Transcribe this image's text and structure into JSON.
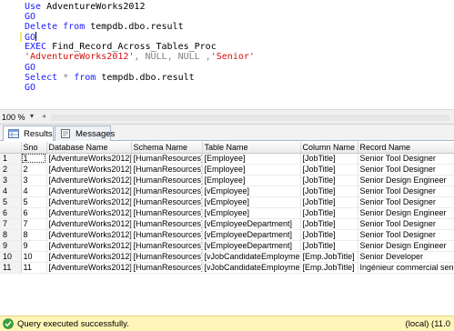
{
  "editor": {
    "lines": [
      {
        "id": "use",
        "parts": [
          {
            "cls": "kw",
            "text": "Use "
          },
          {
            "cls": "txt",
            "text": "AdventureWorks2012"
          }
        ]
      },
      {
        "id": "go1",
        "parts": [
          {
            "cls": "kw",
            "text": "GO"
          }
        ]
      },
      {
        "id": "delete",
        "parts": [
          {
            "cls": "kw",
            "text": "Delete from "
          },
          {
            "cls": "txt",
            "text": "tempdb.dbo.result"
          }
        ]
      },
      {
        "id": "go2",
        "current": true,
        "parts": [
          {
            "cls": "kw",
            "text": "GO"
          }
        ]
      },
      {
        "id": "exec",
        "parts": [
          {
            "cls": "kw",
            "text": "EXEC "
          },
          {
            "cls": "txt",
            "text": "Find_Record_Across_Tables_Proc"
          }
        ]
      },
      {
        "id": "args",
        "parts": [
          {
            "cls": "str",
            "text": "'AdventureWorks2012'"
          },
          {
            "cls": "gray",
            "text": ", "
          },
          {
            "cls": "gray",
            "text": "NULL"
          },
          {
            "cls": "gray",
            "text": ", "
          },
          {
            "cls": "gray",
            "text": "NULL"
          },
          {
            "cls": "gray",
            "text": " ,"
          },
          {
            "cls": "str",
            "text": "'Senior'"
          }
        ]
      },
      {
        "id": "go3",
        "parts": [
          {
            "cls": "kw",
            "text": "GO"
          }
        ]
      },
      {
        "id": "select",
        "parts": [
          {
            "cls": "kw",
            "text": "Select "
          },
          {
            "cls": "gray",
            "text": "* "
          },
          {
            "cls": "kw",
            "text": "from "
          },
          {
            "cls": "txt",
            "text": "tempdb.dbo.result"
          }
        ]
      },
      {
        "id": "go4",
        "parts": [
          {
            "cls": "kw",
            "text": "GO"
          }
        ]
      }
    ]
  },
  "zoom": {
    "value": "100 %",
    "arrow": "▾",
    "scroll_left": "◂"
  },
  "tabs": {
    "results": "Results",
    "messages": "Messages"
  },
  "grid": {
    "columns": [
      "",
      "Sno",
      "Database Name",
      "Schema Name",
      "Table Name",
      "Column Name",
      "Record Name"
    ],
    "rows": [
      [
        "1",
        "1",
        "[AdventureWorks2012]",
        "[HumanResources]",
        "[Employee]",
        "[JobTitle]",
        "Senior Tool Designer"
      ],
      [
        "2",
        "2",
        "[AdventureWorks2012]",
        "[HumanResources]",
        "[Employee]",
        "[JobTitle]",
        "Senior Tool Designer"
      ],
      [
        "3",
        "3",
        "[AdventureWorks2012]",
        "[HumanResources]",
        "[Employee]",
        "[JobTitle]",
        "Senior Design Engineer"
      ],
      [
        "4",
        "4",
        "[AdventureWorks2012]",
        "[HumanResources]",
        "[vEmployee]",
        "[JobTitle]",
        "Senior Tool Designer"
      ],
      [
        "5",
        "5",
        "[AdventureWorks2012]",
        "[HumanResources]",
        "[vEmployee]",
        "[JobTitle]",
        "Senior Tool Designer"
      ],
      [
        "6",
        "6",
        "[AdventureWorks2012]",
        "[HumanResources]",
        "[vEmployee]",
        "[JobTitle]",
        "Senior Design Engineer"
      ],
      [
        "7",
        "7",
        "[AdventureWorks2012]",
        "[HumanResources]",
        "[vEmployeeDepartment]",
        "[JobTitle]",
        "Senior Tool Designer"
      ],
      [
        "8",
        "8",
        "[AdventureWorks2012]",
        "[HumanResources]",
        "[vEmployeeDepartment]",
        "[JobTitle]",
        "Senior Tool Designer"
      ],
      [
        "9",
        "9",
        "[AdventureWorks2012]",
        "[HumanResources]",
        "[vEmployeeDepartment]",
        "[JobTitle]",
        "Senior Design Engineer"
      ],
      [
        "10",
        "10",
        "[AdventureWorks2012]",
        "[HumanResources]",
        "[vJobCandidateEmployment]",
        "[Emp.JobTitle]",
        "Senior Developer"
      ],
      [
        "11",
        "11",
        "[AdventureWorks2012]",
        "[HumanResources]",
        "[vJobCandidateEmployment]",
        "[Emp.JobTitle]",
        "Ingénieur commercial senior"
      ]
    ]
  },
  "status": {
    "message": "Query executed successfully.",
    "server": "(local) (11.0",
    "icon": "success-check-icon",
    "color": "#fff5b8"
  }
}
